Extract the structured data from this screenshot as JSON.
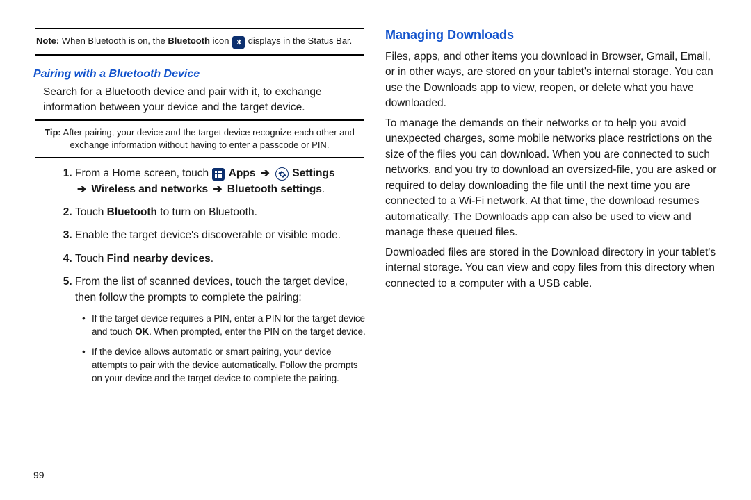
{
  "left": {
    "note": {
      "label": "Note:",
      "before": "When Bluetooth is on, the ",
      "boldword": "Bluetooth",
      "after": " icon ",
      "tail": " displays in the Status Bar."
    },
    "h2": "Pairing with a Bluetooth Device",
    "intro": "Search for a Bluetooth device and pair with it, to exchange information between your device and the target device.",
    "tip": {
      "label": "Tip:",
      "text": "After pairing, your device and the target device recognize each other and exchange information without having to enter a passcode or PIN."
    },
    "steps": {
      "s1": {
        "a": "From a Home screen, touch ",
        "apps": "Apps",
        "settings": "Settings",
        "wireless": "Wireless and networks",
        "bt": "Bluetooth settings",
        "tailpunct": "."
      },
      "s2": {
        "a": "Touch ",
        "b": "Bluetooth",
        "c": " to turn on Bluetooth."
      },
      "s3": "Enable the target device's discoverable or visible mode.",
      "s4": {
        "a": "Touch ",
        "b": "Find nearby devices",
        "c": "."
      },
      "s5": "From the list of scanned devices, touch the target device, then follow the prompts to complete the pairing:",
      "sub1": {
        "a": "If the target device requires a PIN, enter a PIN for the target device and touch ",
        "b": "OK",
        "c": ". When prompted, enter the PIN on the target device."
      },
      "sub2": "If the device allows automatic or smart pairing, your device attempts to pair with the device automatically. Follow the prompts on your device and the target device to complete the pairing."
    }
  },
  "right": {
    "h1": "Managing Downloads",
    "p1": "Files, apps, and other items you download in Browser, Gmail, Email, or in other ways, are stored on your tablet's internal storage. You can use the Downloads app to view, reopen, or delete what you have downloaded.",
    "p2": "To manage the demands on their networks or to help you avoid unexpected charges, some mobile networks place restrictions on the size of the files you can download. When you are connected to such networks, and you try to download an oversized-file, you are asked or required to delay downloading the file until the next time you are connected to a Wi-Fi network. At that time, the download resumes automatically. The Downloads app can also be used to view and manage these queued files.",
    "p3": "Downloaded files are stored in the Download directory in your tablet's internal storage. You can view and copy files from this directory when connected to a computer with a USB cable."
  },
  "pagenum": "99"
}
